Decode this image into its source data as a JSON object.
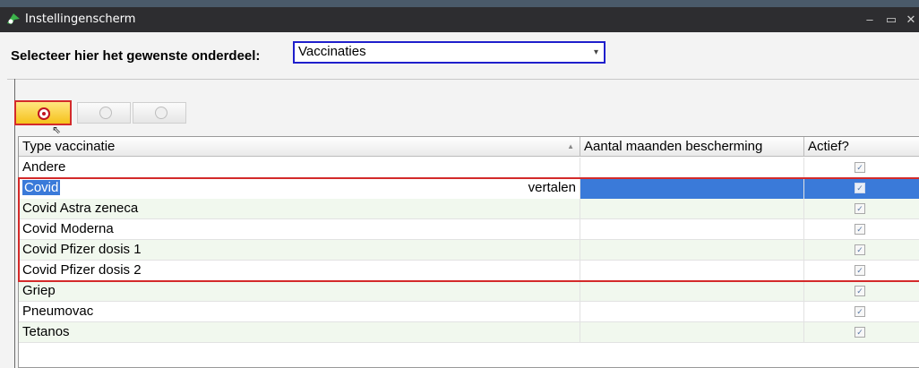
{
  "window": {
    "title": "Instellingenscherm",
    "minimize_glyph": "–",
    "maximize_glyph": "▭",
    "close_glyph": "✕"
  },
  "selector": {
    "label": "Selecteer hier het gewenste onderdeel:",
    "value": "Vaccinaties",
    "caret": "▾"
  },
  "toolbar": {
    "buttons": [
      {
        "name": "add",
        "icon": "add-icon",
        "active": true
      },
      {
        "name": "edit",
        "icon": "edit-icon",
        "active": false
      },
      {
        "name": "delete",
        "icon": "delete-icon",
        "active": false
      }
    ]
  },
  "grid": {
    "columns": [
      "Type vaccinatie",
      "Aantal maanden bescherming",
      "Actief?"
    ],
    "sort_indicator": "▲",
    "rows": [
      {
        "type": "Andere",
        "months": "",
        "active": true
      },
      {
        "type": "Covid",
        "months": "",
        "active": true,
        "hint": "vertalen",
        "selected": true
      },
      {
        "type": "Covid Astra zeneca",
        "months": "",
        "active": true
      },
      {
        "type": "Covid Moderna",
        "months": "",
        "active": true
      },
      {
        "type": "Covid Pfizer dosis 1",
        "months": "",
        "active": true
      },
      {
        "type": "Covid Pfizer dosis 2",
        "months": "",
        "active": true
      },
      {
        "type": "Griep",
        "months": "",
        "active": true
      },
      {
        "type": "Pneumovac",
        "months": "",
        "active": true
      },
      {
        "type": "Tetanos",
        "months": "",
        "active": true
      }
    ]
  },
  "colors": {
    "titlebar": "#2d2d30",
    "selection": "#3a7ad9",
    "highlight_border": "#d32a2a",
    "select_border": "#1f1fcc"
  }
}
